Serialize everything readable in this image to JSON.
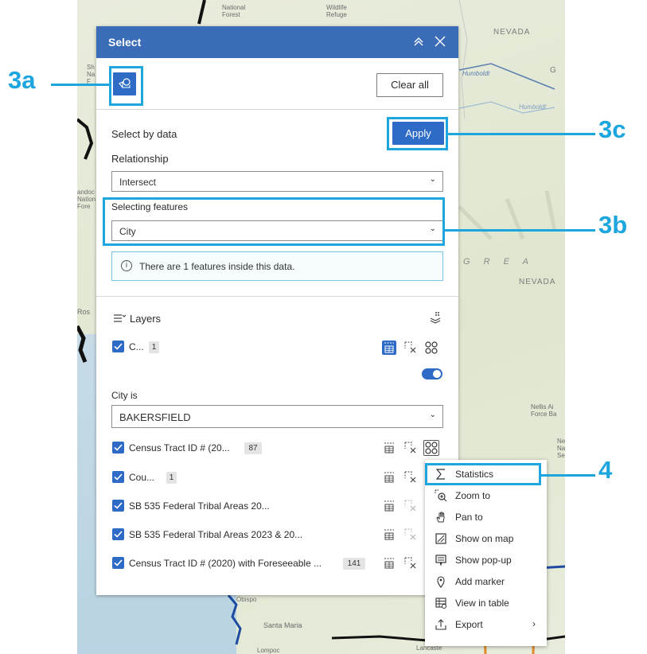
{
  "map": {
    "labels": {
      "national_forest": "National\nForest",
      "wildlife_refuge": "Wildlife\nRefuge",
      "nevada_top": "NEVADA",
      "humboldt_1": "Humboldt",
      "humboldt_2": "Humboldt",
      "g_letter": "G",
      "great": "G R E A",
      "nevada_mid": "NEVADA",
      "nellis": "Nellis Ai\nForce Ba",
      "ne_na_se": "Ne\nNa\nSe",
      "obispo": "Obispo",
      "santa_maria": "Santa Maria",
      "lompoc": "Lompoc",
      "lancaster": "Lancaste",
      "ros": "Ros",
      "sandoc": "andoc\nNation\nFore",
      "shasta": "Sh\nNa\nF"
    }
  },
  "callouts": {
    "a": "3a",
    "b": "3b",
    "c": "3c",
    "d": "4"
  },
  "panel": {
    "title": "Select",
    "clear_all": "Clear all",
    "select_by_data": "Select by data",
    "apply": "Apply",
    "relationship_label": "Relationship",
    "relationship_value": "Intersect",
    "selecting_features_label": "Selecting features",
    "selecting_features_value": "City",
    "notice": "There are 1 features inside this data.",
    "layers_label": "Layers",
    "layer1_name": "C...",
    "layer1_count": "1",
    "city_is_label": "City is",
    "city_value": "BAKERSFIELD",
    "layers": [
      {
        "name": "Census Tract ID # (20...",
        "count": "87"
      },
      {
        "name": "Cou...",
        "count": "1"
      },
      {
        "name": "SB 535 Federal Tribal Areas 20...",
        "count": ""
      },
      {
        "name": "SB 535 Federal Tribal Areas 2023 & 20...",
        "count": ""
      },
      {
        "name": "Census Tract ID # (2020) with Foreseeable ...",
        "count": "141"
      }
    ]
  },
  "menu": {
    "items": [
      {
        "label": "Statistics",
        "icon": "sigma-icon"
      },
      {
        "label": "Zoom to",
        "icon": "zoom-to-icon"
      },
      {
        "label": "Pan to",
        "icon": "hand-icon"
      },
      {
        "label": "Show on map",
        "icon": "map-check-icon"
      },
      {
        "label": "Show pop-up",
        "icon": "popup-icon"
      },
      {
        "label": "Add marker",
        "icon": "marker-icon"
      },
      {
        "label": "View in table",
        "icon": "table-icon"
      },
      {
        "label": "Export",
        "icon": "export-icon"
      }
    ],
    "export_arrow": "›"
  },
  "colors": {
    "header": "#3a6cb8",
    "primary": "#2e6bc6",
    "callout": "#1da6de"
  }
}
